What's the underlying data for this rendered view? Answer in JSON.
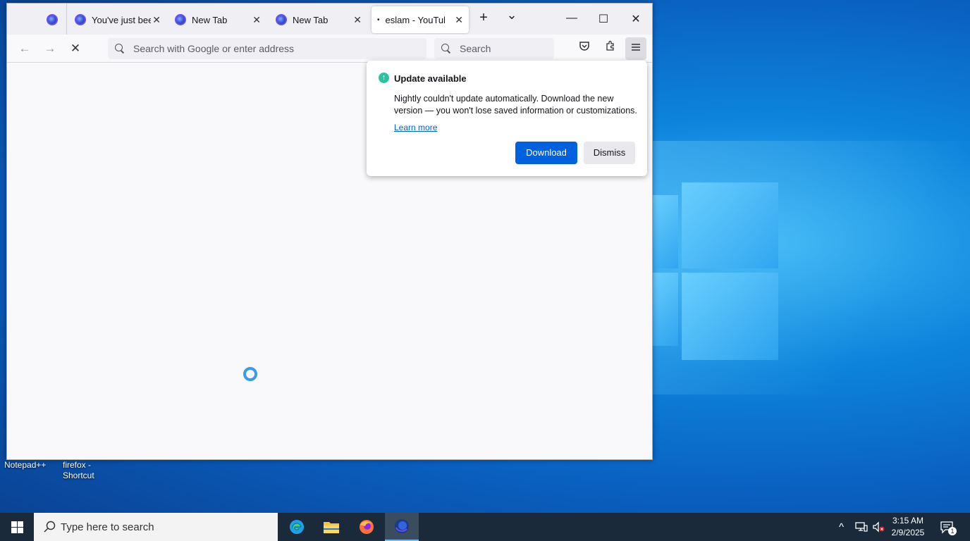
{
  "desktop": {
    "icons": [
      {
        "label": "Notepad++"
      },
      {
        "label": "firefox -\nShortcut"
      }
    ]
  },
  "browser": {
    "tabs": [
      {
        "title": ""
      },
      {
        "title": "You've just been",
        "close": "✕"
      },
      {
        "title": "New Tab",
        "close": "✕"
      },
      {
        "title": "New Tab",
        "close": "✕"
      },
      {
        "title": "eslam - YouTube",
        "close": "✕",
        "active": true
      }
    ],
    "new_tab": "+",
    "tab_list": "⌄",
    "window_controls": {
      "minimize": "—",
      "maximize": "☐",
      "close": "✕"
    },
    "nav": {
      "back": "←",
      "forward": "→",
      "stop": "✕"
    },
    "urlbar_placeholder": "Search with Google or enter address",
    "searchbar_placeholder": "Search",
    "toolbar_icons": [
      "pocket-icon",
      "extensions-icon",
      "menu-icon"
    ]
  },
  "update_popup": {
    "title": "Update available",
    "body": "Nightly couldn't update automatically. Download the new version — you won't lose saved information or customizations.",
    "link": "Learn more",
    "download": "Download",
    "dismiss": "Dismiss",
    "accent": "#0061e0"
  },
  "taskbar": {
    "search_placeholder": "Type here to search",
    "apps": [
      "edge-icon",
      "file-explorer-icon",
      "firefox-icon",
      "firefox-nightly-icon"
    ],
    "tray": {
      "chevron": "^"
    },
    "time": "3:15 AM",
    "date": "2/9/2025",
    "notification_count": "1"
  }
}
